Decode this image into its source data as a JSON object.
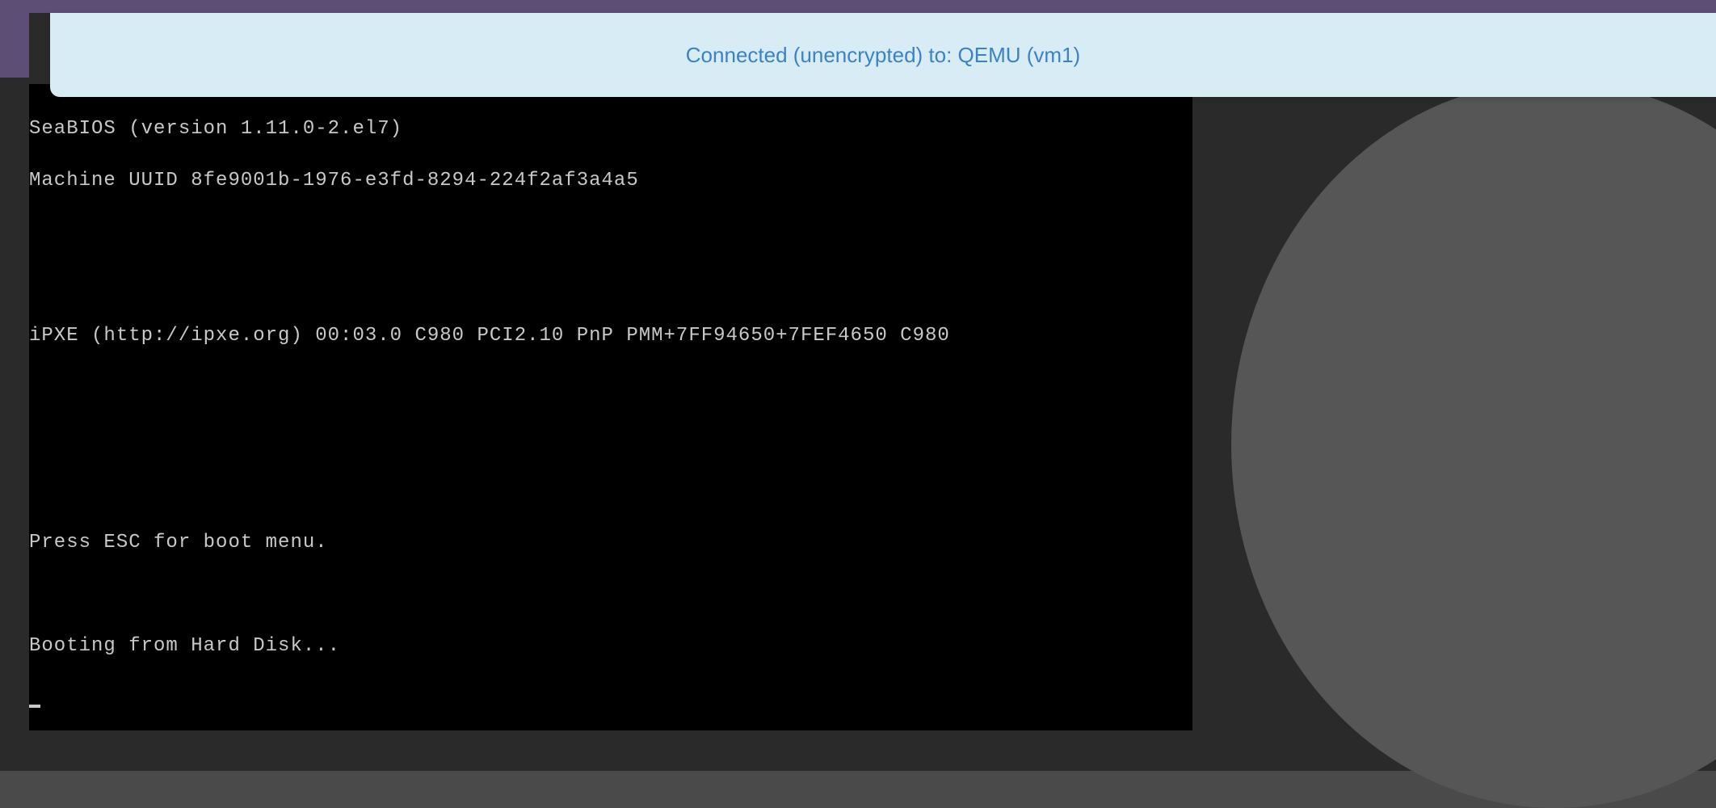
{
  "notification": {
    "text": "Connected (unencrypted) to: QEMU (vm1)"
  },
  "terminal": {
    "lines": [
      "SeaBIOS (version 1.11.0-2.el7)",
      "Machine UUID 8fe9001b-1976-e3fd-8294-224f2af3a4a5",
      "",
      "",
      "iPXE (http://ipxe.org) 00:03.0 C980 PCI2.10 PnP PMM+7FF94650+7FEF4650 C980",
      "",
      "",
      "",
      "Press ESC for boot menu.",
      "",
      "Booting from Hard Disk..."
    ]
  }
}
